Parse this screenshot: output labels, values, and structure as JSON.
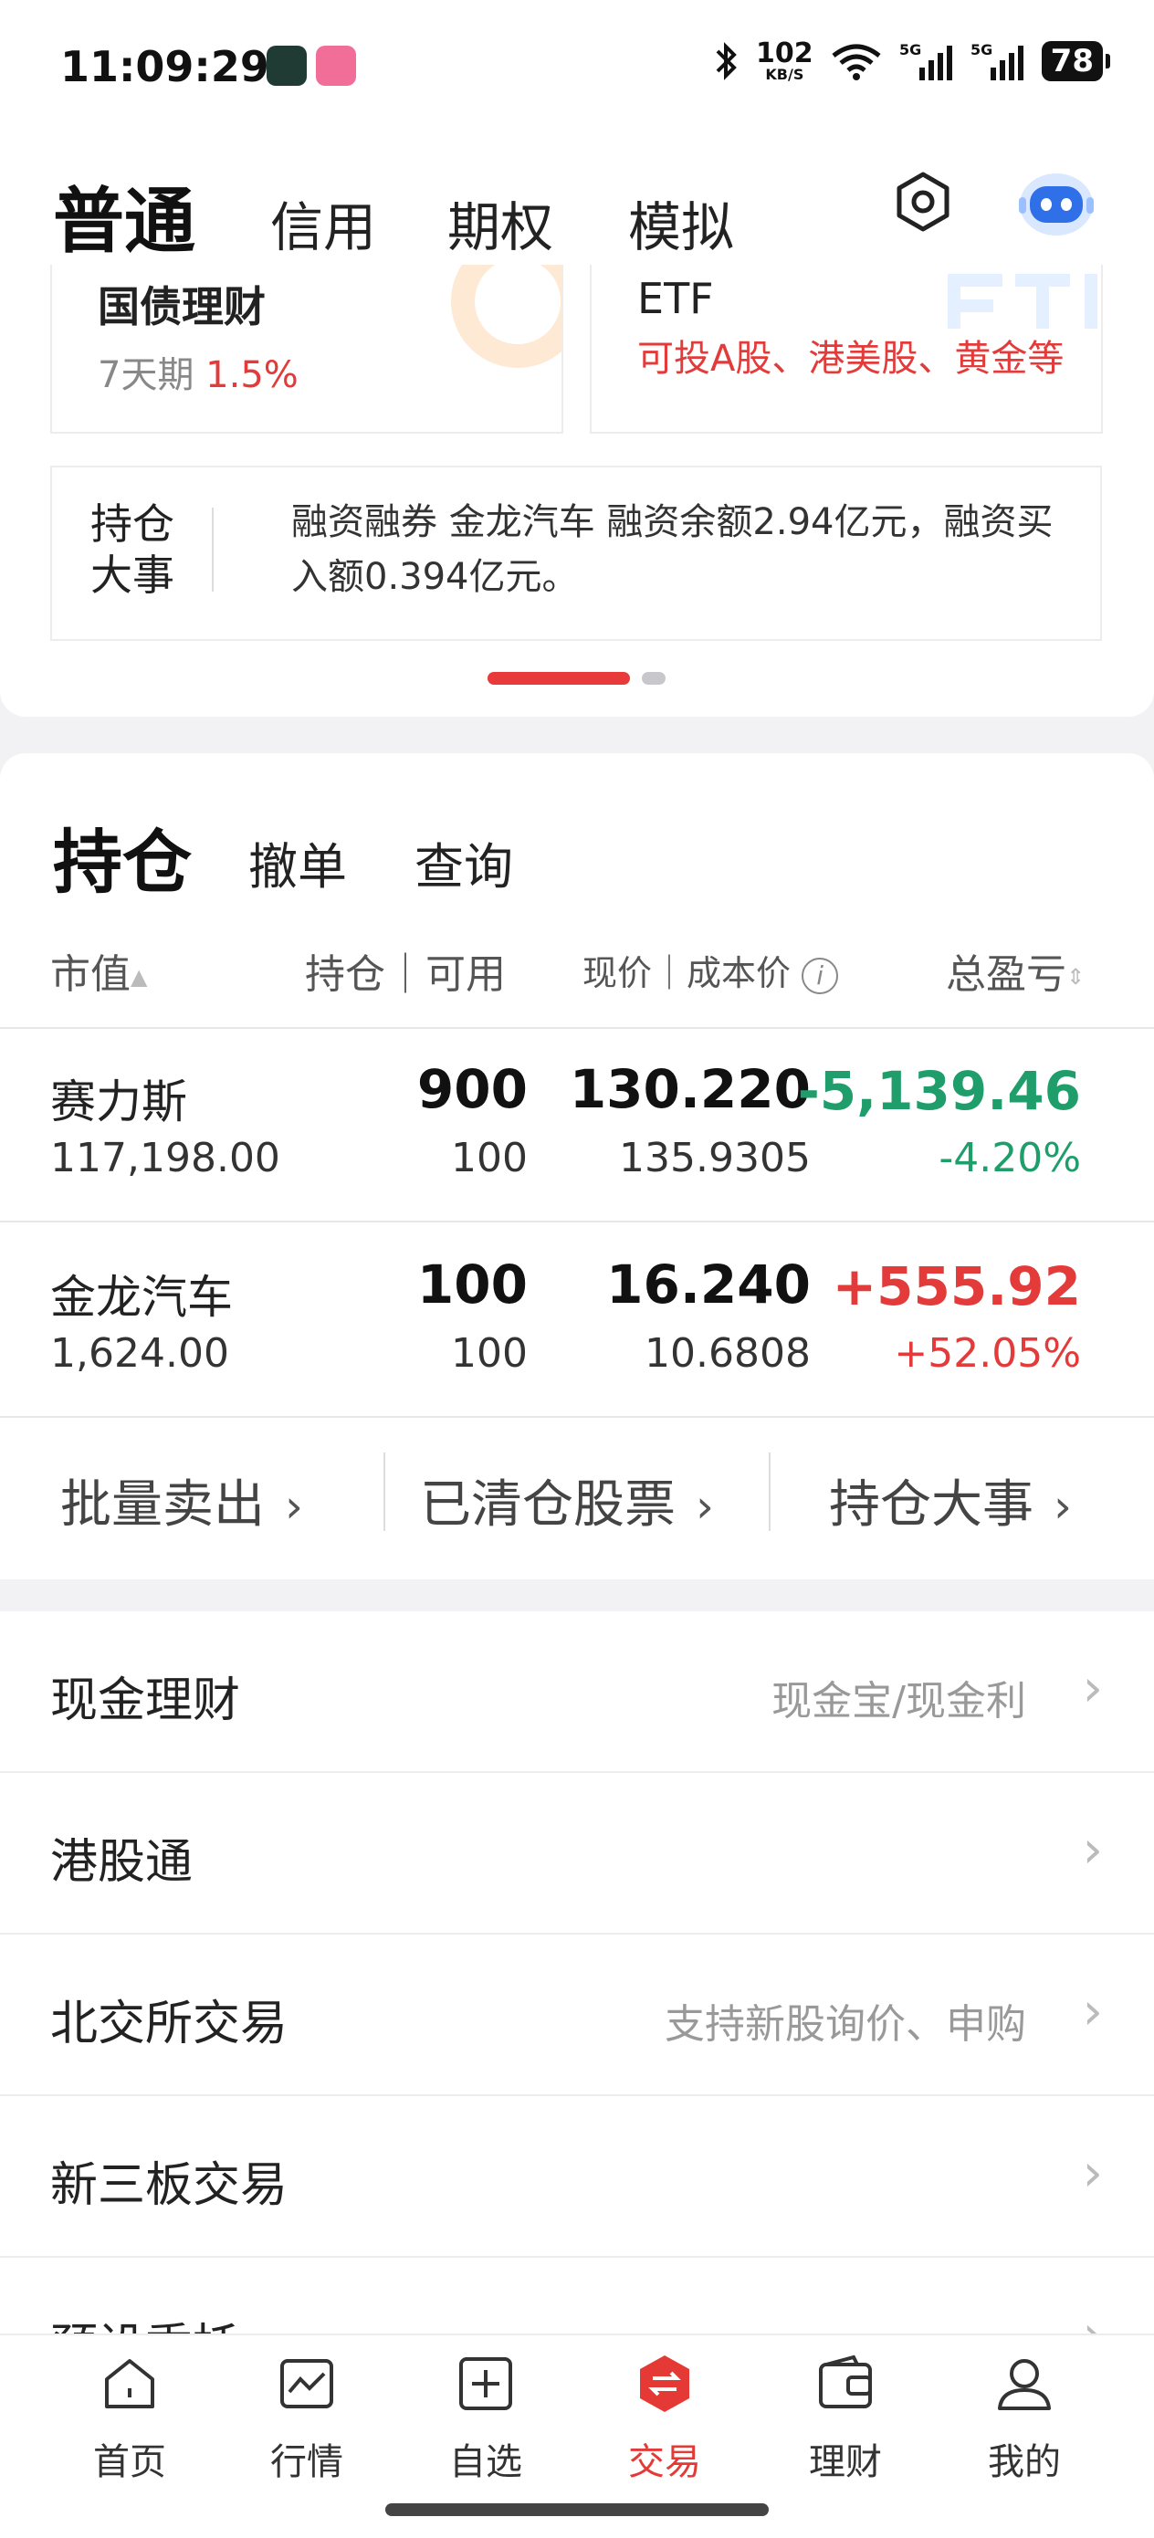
{
  "status": {
    "time": "11:09:29",
    "net_speed": "102",
    "net_unit": "KB/S",
    "sig1": "5G",
    "sig2": "5G",
    "battery": "78"
  },
  "header": {
    "tabs": [
      "普通",
      "信用",
      "期权",
      "模拟"
    ]
  },
  "promos": [
    {
      "title": "国债理财",
      "sub_gray": "7天期",
      "sub_red": "1.5%"
    },
    {
      "title": "ETF",
      "sub_red": "可投A股、港美股、黄金等"
    }
  ],
  "news": {
    "label_line1": "持仓",
    "label_line2": "大事",
    "text": "融资融券 金龙汽车 融资余额2.94亿元，融资买入额0.394亿元。"
  },
  "holdings": {
    "tabs": [
      "持仓",
      "撤单",
      "查询"
    ],
    "columns": {
      "market_value": "市值",
      "position": "持仓｜可用",
      "price": "现价｜成本价",
      "pl": "总盈亏"
    },
    "rows": [
      {
        "name": "赛力斯",
        "market_value": "117,198.00",
        "qty": "900",
        "available": "100",
        "price": "130.220",
        "cost": "135.9305",
        "pl": "-5,139.46",
        "pl_pct": "-4.20%",
        "trend": "down"
      },
      {
        "name": "金龙汽车",
        "market_value": "1,624.00",
        "qty": "100",
        "available": "100",
        "price": "16.240",
        "cost": "10.6808",
        "pl": "+555.92",
        "pl_pct": "+52.05%",
        "trend": "up"
      }
    ],
    "actions": [
      "批量卖出",
      "已清仓股票",
      "持仓大事"
    ]
  },
  "list": [
    {
      "title": "现金理财",
      "sub": "现金宝/现金利"
    },
    {
      "title": "港股通",
      "sub": ""
    },
    {
      "title": "北交所交易",
      "sub": "支持新股询价、申购"
    },
    {
      "title": "新三板交易",
      "sub": ""
    },
    {
      "title": "预设委托",
      "sub": ""
    }
  ],
  "nav": [
    "首页",
    "行情",
    "自选",
    "交易",
    "理财",
    "我的"
  ],
  "colors": {
    "accent": "#e53935",
    "gain": "#e33a3a",
    "loss": "#1f9e6c"
  }
}
